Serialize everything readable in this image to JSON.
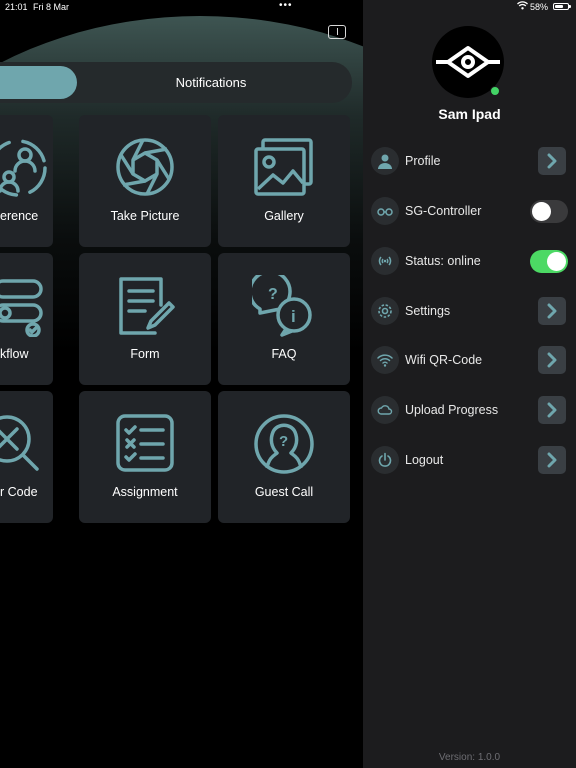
{
  "status_bar": {
    "time": "21:01",
    "date": "Fri 8 Mar",
    "dots": "•••",
    "battery": "58%"
  },
  "tabs": {
    "notifications": "Notifications"
  },
  "tiles": [
    {
      "label": "erence",
      "icon": "conference-icon"
    },
    {
      "label": "Take Picture",
      "icon": "camera-aperture-icon"
    },
    {
      "label": "Gallery",
      "icon": "gallery-icon"
    },
    {
      "label": "kflow",
      "icon": "workflow-icon"
    },
    {
      "label": "Form",
      "icon": "form-icon"
    },
    {
      "label": "FAQ",
      "icon": "faq-icon"
    },
    {
      "label": "r Code",
      "icon": "qr-search-icon"
    },
    {
      "label": "Assignment",
      "icon": "assignment-icon"
    },
    {
      "label": "Guest Call",
      "icon": "guest-call-icon"
    }
  ],
  "profile": {
    "name": "Sam Ipad",
    "presence": "online"
  },
  "menu": {
    "profile": "Profile",
    "sg_controller": "SG-Controller",
    "status": "Status: online",
    "settings": "Settings",
    "wifi_qr": "Wifi QR-Code",
    "upload": "Upload Progress",
    "logout": "Logout"
  },
  "toggles": {
    "sg_controller": false,
    "status_online": true
  },
  "version": "Version: 1.0.0",
  "colors": {
    "accent": "#6fa6ad",
    "panel": "#1c1c1e",
    "tile": "#212428",
    "toggle_on": "#4cd964"
  }
}
